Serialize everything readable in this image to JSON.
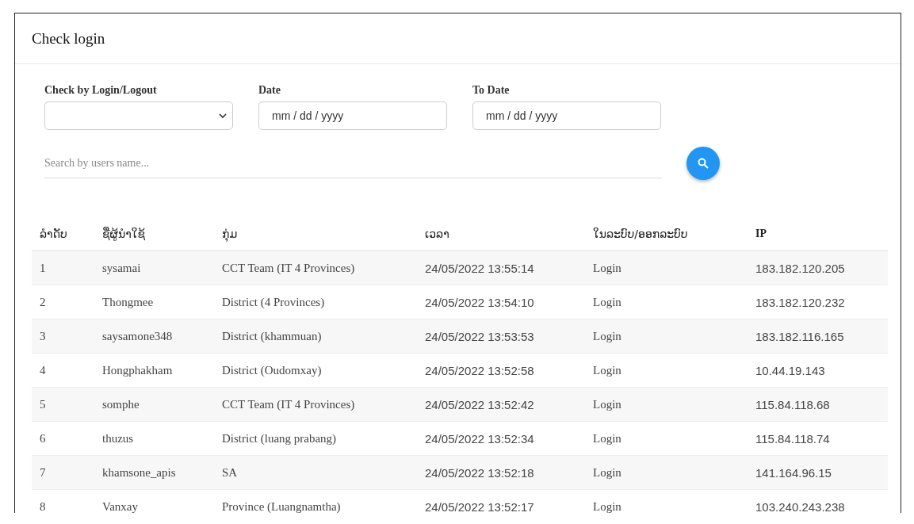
{
  "page": {
    "title": "Check login"
  },
  "filters": [
    {
      "kind": "select",
      "label": "Check by Login/Logout"
    },
    {
      "kind": "date",
      "label": "Date",
      "placeholder": "mm / dd / yyyy"
    },
    {
      "kind": "date",
      "label": "To Date",
      "placeholder": "mm / dd / yyyy"
    }
  ],
  "search": {
    "placeholder": "Search by users name..."
  },
  "table": {
    "columns": [
      "ລຳດັບ",
      "ຊື່ຜູ້ນຳໃຊ້",
      "ກຸ່ມ",
      "ເວລາ",
      "ໃນລະບົບ/ອອກລະບົບ",
      "IP"
    ],
    "rows": [
      [
        "1",
        "sysamai",
        "CCT Team (IT 4 Provinces)",
        "24/05/2022 13:55:14",
        "Login",
        "183.182.120.205"
      ],
      [
        "2",
        "Thongmee",
        "District (4 Provinces)",
        "24/05/2022 13:54:10",
        "Login",
        "183.182.120.232"
      ],
      [
        "3",
        "saysamone348",
        "District (khammuan)",
        "24/05/2022 13:53:53",
        "Login",
        "183.182.116.165"
      ],
      [
        "4",
        "Hongphakham",
        "District (Oudomxay)",
        "24/05/2022 13:52:58",
        "Login",
        "10.44.19.143"
      ],
      [
        "5",
        "somphe",
        "CCT Team (IT 4 Provinces)",
        "24/05/2022 13:52:42",
        "Login",
        "115.84.118.68"
      ],
      [
        "6",
        "thuzus",
        "District (luang prabang)",
        "24/05/2022 13:52:34",
        "Login",
        "115.84.118.74"
      ],
      [
        "7",
        "khamsone_apis",
        "SA",
        "24/05/2022 13:52:18",
        "Login",
        "141.164.96.15"
      ],
      [
        "8",
        "Vanxay",
        "Province (Luangnamtha)",
        "24/05/2022 13:52:17",
        "Login",
        "103.240.243.238"
      ]
    ]
  }
}
